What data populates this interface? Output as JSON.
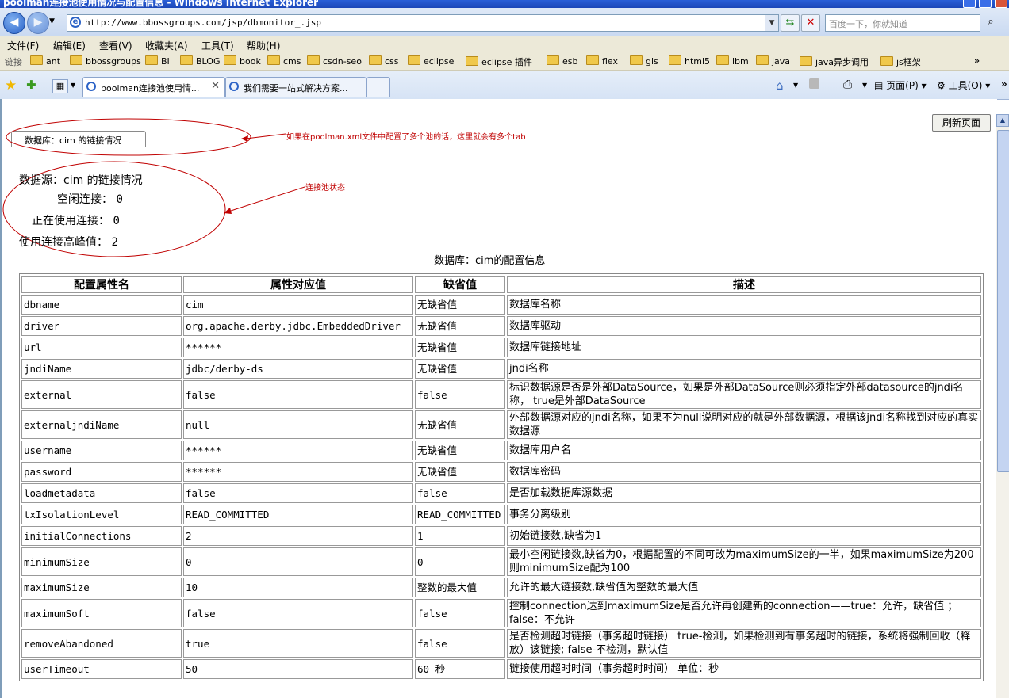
{
  "window": {
    "title": "poolman连接池使用情况与配置信息 - Windows Internet Explorer"
  },
  "address_bar": {
    "url": "http://www.bbossgroups.com/jsp/dbmonitor_.jsp"
  },
  "search": {
    "placeholder": "百度一下，你就知道"
  },
  "menu": [
    "文件(F)",
    "编辑(E)",
    "查看(V)",
    "收藏夹(A)",
    "工具(T)",
    "帮助(H)"
  ],
  "links_bar": {
    "label": "链接",
    "items": [
      "ant",
      "bbossgroups",
      "BI",
      "BLOG",
      "book",
      "cms",
      "csdn-seo",
      "css",
      "eclipse",
      "eclipse 插件",
      "esb",
      "flex",
      "gis",
      "html5",
      "ibm",
      "java",
      "java异步调用",
      "js框架"
    ],
    "overflow": "»"
  },
  "tabs": [
    {
      "label": "poolman连接池使用情..."
    },
    {
      "label": "我们需要一站式解决方案..."
    }
  ],
  "toolbar": {
    "page_label": "页面(P)",
    "tools_label": "工具(O)"
  },
  "page": {
    "refresh_button": "刷新页面",
    "db_tab": "数据库：cim 的链接情况",
    "annotation_tabs": "如果在poolman.xml文件中配置了多个池的话，这里就会有多个tab",
    "annotation_status": "连接池状态",
    "status": {
      "heading": "数据源：cim 的链接情况",
      "idle_label": "空闲连接：",
      "idle_value": "0",
      "active_label": "正在使用连接：",
      "active_value": "0",
      "peak_label": "使用连接高峰值：",
      "peak_value": "2"
    },
    "config_caption": "数据库：cim的配置信息",
    "table": {
      "headers": [
        "配置属性名",
        "属性对应值",
        "缺省值",
        "描述"
      ],
      "rows": [
        [
          "dbname",
          "cim",
          "无缺省值",
          "数据库名称"
        ],
        [
          "driver",
          "org.apache.derby.jdbc.EmbeddedDriver",
          "无缺省值",
          "数据库驱动"
        ],
        [
          "url",
          "******",
          "无缺省值",
          "数据库链接地址"
        ],
        [
          "jndiName",
          "jdbc/derby-ds",
          "无缺省值",
          "jndi名称"
        ],
        [
          "external",
          "false",
          "false",
          "标识数据源是否是外部DataSource，如果是外部DataSource则必须指定外部datasource的jndi名称， true是外部DataSource"
        ],
        [
          "externaljndiName",
          "null",
          "无缺省值",
          "外部数据源对应的jndi名称，如果不为null说明对应的就是外部数据源，根据该jndi名称找到对应的真实数据源"
        ],
        [
          "username",
          "******",
          "无缺省值",
          "数据库用户名"
        ],
        [
          "password",
          "******",
          "无缺省值",
          "数据库密码"
        ],
        [
          "loadmetadata",
          "false",
          "false",
          "是否加载数据库源数据"
        ],
        [
          "txIsolationLevel",
          "READ_COMMITTED",
          "READ_COMMITTED",
          "事务分离级别"
        ],
        [
          "initialConnections",
          "2",
          "1",
          "初始链接数,缺省为1"
        ],
        [
          "minimumSize",
          "0",
          "0",
          "最小空闲链接数,缺省为0，根据配置的不同可改为maximumSize的一半，如果maximumSize为200则minimumSize配为100"
        ],
        [
          "maximumSize",
          "10",
          "整数的最大值",
          "允许的最大链接数,缺省值为整数的最大值"
        ],
        [
          "maximumSoft",
          "false",
          "false",
          "控制connection达到maximumSize是否允许再创建新的connection——true：允许，缺省值 ；false：不允许"
        ],
        [
          "removeAbandoned",
          "true",
          "false",
          "是否检测超时链接（事务超时链接） true-检测，如果检测到有事务超时的链接，系统将强制回收（释放）该链接; false-不检测，默认值"
        ],
        [
          "userTimeout",
          "50",
          "60 秒",
          "链接使用超时时间（事务超时时间） 单位：秒"
        ]
      ]
    }
  }
}
